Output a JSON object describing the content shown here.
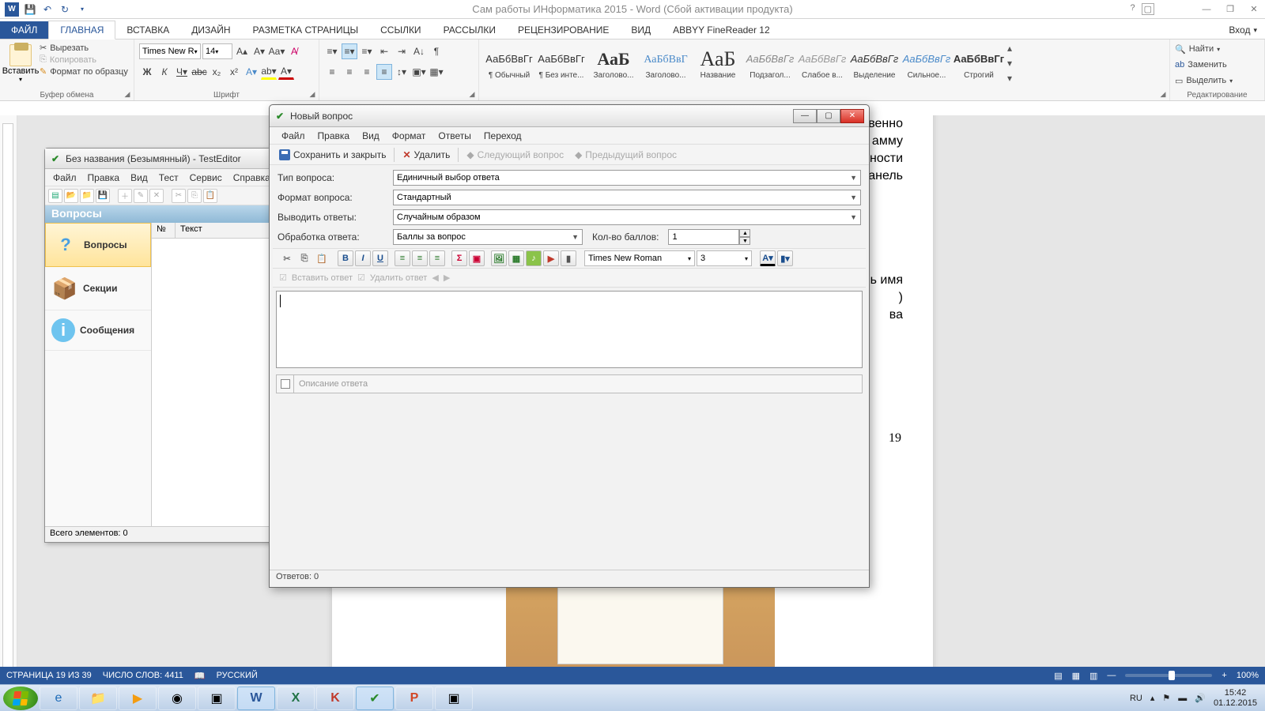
{
  "word": {
    "title": "Сам работы ИНформатика 2015 - Word (Сбой активации продукта)",
    "login": "Вход",
    "tabs": {
      "file": "ФАЙЛ",
      "home": "ГЛАВНАЯ",
      "insert": "ВСТАВКА",
      "design": "ДИЗАЙН",
      "layout": "РАЗМЕТКА СТРАНИЦЫ",
      "refs": "ССЫЛКИ",
      "mail": "РАССЫЛКИ",
      "review": "РЕЦЕНЗИРОВАНИЕ",
      "view": "ВИД",
      "abbyy": "ABBYY FineReader 12"
    },
    "clipboard": {
      "paste": "Вставить",
      "cut": "Вырезать",
      "copy": "Копировать",
      "format": "Формат по образцу",
      "group": "Буфер обмена"
    },
    "font": {
      "name": "Times New R",
      "size": "14",
      "group": "Шрифт"
    },
    "styles": {
      "normal": "¶ Обычный",
      "nospace": "¶ Без инте...",
      "h1": "Заголово...",
      "h2": "Заголово...",
      "title": "Название",
      "subtitle": "Подзагол...",
      "weak": "Слабое в...",
      "emph": "Выделение",
      "strong": "Сильное...",
      "strict": "Строгий",
      "sample": "АаБбВвГг",
      "sample_b": "АаБбВвГ",
      "sample_big": "АаБ",
      "sample_t": "АаБ",
      "sample_sub": "АаБбВвГг",
      "sample_w": "АаБбВвГг",
      "sample_e": "АаБбВвГг",
      "sample_s": "АаБбВвГг",
      "sample_str": "АаБбВвГг"
    },
    "edit": {
      "find": "Найти",
      "replace": "Заменить",
      "select": "Выделить",
      "group": "Редактирование"
    },
    "status": {
      "page": "СТРАНИЦА 19 ИЗ 39",
      "words": "ЧИСЛО СЛОВ: 4411",
      "lang": "РУССКИЙ",
      "zoom": "100%"
    },
    "doc": {
      "pnum": "19",
      "frag1": "венно",
      "frag2": "амму",
      "frag3": "ности",
      "frag4": "анель",
      "frag5": "ь имя",
      "frag6": ")",
      "frag7": "ва"
    }
  },
  "testeditor": {
    "title": "Без названия (Безымянный) - TestEditor",
    "menu": {
      "file": "Файл",
      "edit": "Правка",
      "view": "Вид",
      "test": "Тест",
      "service": "Сервис",
      "help": "Справка"
    },
    "panel": "Вопросы",
    "side": {
      "questions": "Вопросы",
      "sections": "Секции",
      "messages": "Сообщения"
    },
    "cols": {
      "num": "№",
      "text": "Текст"
    },
    "status": "Всего элементов: 0"
  },
  "nq": {
    "title": "Новый вопрос",
    "menu": {
      "file": "Файл",
      "edit": "Правка",
      "view": "Вид",
      "format": "Формат",
      "answers": "Ответы",
      "nav": "Переход"
    },
    "tb": {
      "save": "Сохранить и закрыть",
      "del": "Удалить",
      "next": "Следующий вопрос",
      "prev": "Предыдущий вопрос"
    },
    "form": {
      "type_l": "Тип вопроса:",
      "type_v": "Единичный выбор ответа",
      "fmt_l": "Формат вопроса:",
      "fmt_v": "Стандартный",
      "out_l": "Выводить ответы:",
      "out_v": "Случайным образом",
      "proc_l": "Обработка ответа:",
      "proc_v": "Баллы за вопрос",
      "score_l": "Кол-во баллов:",
      "score_v": "1"
    },
    "editor": {
      "font": "Times New Roman",
      "size": "3"
    },
    "ans_tb": {
      "ins": "Вставить ответ",
      "del": "Удалить ответ"
    },
    "ans_ph": "Описание ответа",
    "status": "Ответов: 0"
  },
  "taskbar": {
    "lang": "RU",
    "time": "15:42",
    "date": "01.12.2015"
  }
}
